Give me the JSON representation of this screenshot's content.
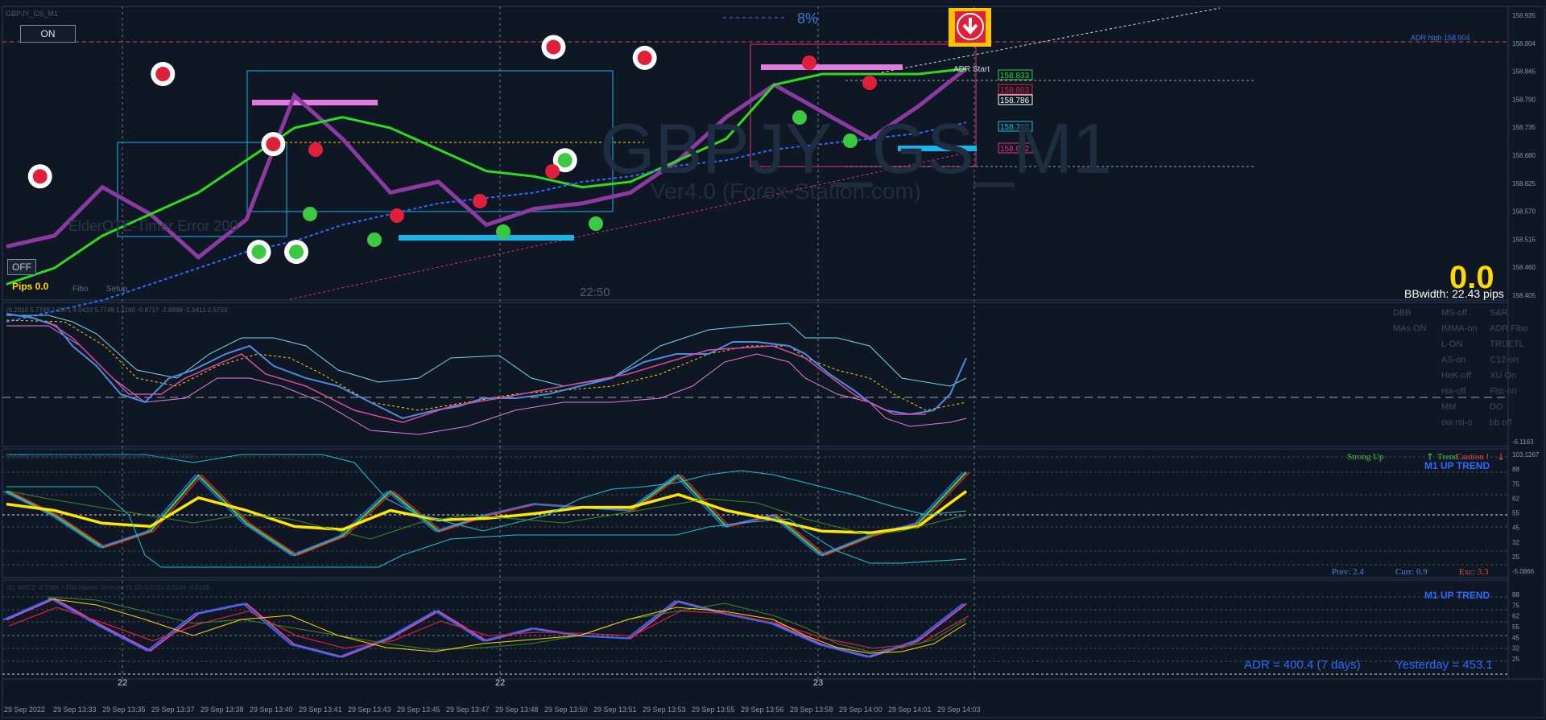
{
  "window": {
    "top_label": "GBPJY_GS_M1",
    "on_button": "ON",
    "off_button": "OFF"
  },
  "main_panel": {
    "watermark_symbol": "GBPJY_GS_M1",
    "watermark_brand": "Ver4.0 (Forex-Station.com)",
    "error_text": "ElderOTE-Timer Error 200",
    "pips_text": "Pips 0.0",
    "fibo_label": "Fibo",
    "setup_label": "Setup",
    "time_label": "22:50",
    "percent_label": "8%",
    "big_value": "0.0",
    "bbwidth_text": "BBwidth: 22.43 pips",
    "adr_label": "ADR Start",
    "price_tags": [
      {
        "text": "158.833",
        "color": "#2ecc40"
      },
      {
        "text": "158.803",
        "color": "#e0203a"
      },
      {
        "text": "158.786",
        "color": "#ffffff"
      },
      {
        "text": "158.735",
        "color": "#19c3d8"
      },
      {
        "text": "158.682",
        "color": "#e0307a"
      }
    ],
    "adr_right_tag": "ADR high 158.904",
    "axis_ticks": [
      "158.935",
      "158.904",
      "158.845",
      "158.790",
      "158.735",
      "158.680",
      "158.625",
      "158.570",
      "158.515",
      "158.460",
      "158.405"
    ]
  },
  "panel2": {
    "title": "(0.2010 5.7749 1.2871 4.0433 5.7749 1.1160 -0.8717 -2.9999 -1.9411 2.5733",
    "buttons": [
      [
        "DBB",
        "MS-off",
        "S&R"
      ],
      [
        "MAs ON",
        "IMMA-on",
        "ADR Fibo"
      ],
      [
        "",
        "L-ON",
        "TRUETL"
      ],
      [
        "",
        "AS-on",
        "C12-on"
      ],
      [
        "",
        "HeK-off",
        "XU On"
      ],
      [
        "",
        "rsx-off",
        "Fist-on"
      ],
      [
        "",
        "MM",
        "DO"
      ],
      [
        "",
        "ow rsi-o",
        "bb off"
      ]
    ],
    "right_value": "-6.1163"
  },
  "panel3": {
    "title": "(Ehlers) (28.84 (10.8) 63.8312 68.4734 55.1395 70.5963 84.5599)",
    "strong_up": "Strong Up",
    "trend": "Trend",
    "caution": "Caution !",
    "trend_label": "M1 UP TREND",
    "prev": "Prev: 2.4",
    "curr": "Curr: 0.9",
    "exc": "Exc: 3.3",
    "axis_ticks": [
      "103.1267",
      "88",
      "75",
      "62",
      "55",
      "45",
      "32",
      "25",
      "-5.0866"
    ]
  },
  "panel4": {
    "title": "M1 MACD of EMA + Flat Market Detector (8,13) 0.0251 0.0184 -0.0118",
    "trend_label": "M1 UP TREND",
    "adr_text": "ADR = 400.4  (7 days)",
    "yesterday_text": "Yesterday = 453.1",
    "axis_ticks": [
      "88",
      "75",
      "62",
      "55",
      "45",
      "32",
      "25"
    ]
  },
  "x_axis": {
    "day_markers": [
      "22",
      "22",
      "23"
    ],
    "time_labels": [
      "29 Sep 2022",
      "29 Sep 13:33",
      "29 Sep 13:35",
      "29 Sep 13:37",
      "29 Sep 13:38",
      "29 Sep 13:40",
      "29 Sep 13:41",
      "29 Sep 13:43",
      "29 Sep 13:45",
      "29 Sep 13:47",
      "29 Sep 13:48",
      "29 Sep 13:50",
      "29 Sep 13:51",
      "29 Sep 13:53",
      "29 Sep 13:55",
      "29 Sep 13:56",
      "29 Sep 13:58",
      "29 Sep 14:00",
      "29 Sep 14:01",
      "29 Sep 14:03"
    ]
  },
  "colors": {
    "background": "#0f1724",
    "panel_border": "#2a3a52",
    "grid": "#6f7c8c",
    "green_line": "#2ddc1c",
    "purple_line": "#8a3aa0",
    "blue_dash": "#2a6bff",
    "yellow": "#ffe600",
    "red_dot": "#e0203a",
    "green_dot": "#3ac940",
    "cyan_bar": "#18b4ec",
    "pink_bar": "#e07ce0"
  },
  "chart_data": [
    {
      "type": "line",
      "panel": "price",
      "title": "",
      "xlabel": "",
      "ylabel": "",
      "ylim": [
        158.405,
        158.935
      ],
      "x": [
        0,
        5,
        10,
        15,
        20,
        25,
        30,
        35,
        40,
        45,
        50,
        55,
        60,
        65,
        70,
        75,
        80,
        85,
        90,
        95,
        100
      ],
      "series": [
        {
          "name": "",
          "key": "price",
          "values": [
            158.5,
            158.52,
            158.61,
            158.56,
            158.48,
            158.55,
            158.78,
            158.7,
            158.6,
            158.62,
            158.54,
            158.57,
            158.58,
            158.6,
            158.66,
            158.74,
            158.8,
            158.75,
            158.7,
            158.76,
            158.83
          ]
        },
        {
          "name": "",
          "key": "ma_green",
          "values": [
            158.43,
            158.46,
            158.52,
            158.56,
            158.6,
            158.66,
            158.72,
            158.74,
            158.72,
            158.68,
            158.64,
            158.63,
            158.61,
            158.62,
            158.66,
            158.7,
            158.8,
            158.82,
            158.82,
            158.82,
            158.83
          ]
        },
        {
          "name": "",
          "key": "ma_blue",
          "values": [
            158.36,
            158.38,
            158.4,
            158.43,
            158.46,
            158.49,
            158.51,
            158.54,
            158.56,
            158.58,
            158.59,
            158.6,
            158.62,
            158.63,
            158.65,
            158.66,
            158.68,
            158.69,
            158.7,
            158.71,
            158.73
          ]
        }
      ],
      "markers": [
        {
          "type": "red",
          "x": 3.5,
          "y": 158.63
        },
        {
          "type": "red",
          "x": 16.3,
          "y": 158.82
        },
        {
          "type": "red",
          "x": 27.8,
          "y": 158.69
        },
        {
          "type": "red",
          "x": 57.0,
          "y": 158.87
        },
        {
          "type": "red",
          "x": 66.5,
          "y": 158.85
        },
        {
          "type": "green",
          "x": 26.3,
          "y": 158.49
        },
        {
          "type": "green",
          "x": 30.2,
          "y": 158.49
        },
        {
          "type": "green",
          "x": 58.2,
          "y": 158.66
        }
      ]
    },
    {
      "type": "line",
      "panel": "panel3",
      "title": "",
      "xlabel": "",
      "ylabel": "",
      "ylim": [
        25,
        88
      ],
      "x": [
        0,
        5,
        10,
        15,
        20,
        25,
        30,
        35,
        40,
        45,
        50,
        55,
        60,
        65,
        70,
        75,
        80,
        85,
        90,
        95,
        100
      ],
      "series": [
        {
          "name": "",
          "key": "fast",
          "values": [
            70,
            55,
            35,
            45,
            80,
            50,
            30,
            42,
            70,
            45,
            55,
            62,
            60,
            58,
            80,
            48,
            55,
            30,
            42,
            50,
            82
          ]
        },
        {
          "name": "",
          "key": "slow",
          "values": [
            62,
            58,
            50,
            48,
            66,
            58,
            48,
            46,
            58,
            52,
            53,
            56,
            60,
            60,
            68,
            58,
            52,
            45,
            44,
            48,
            70
          ]
        }
      ]
    },
    {
      "type": "line",
      "panel": "panel4",
      "title": "",
      "xlabel": "",
      "ylabel": "",
      "ylim": [
        25,
        88
      ],
      "x": [
        0,
        5,
        10,
        15,
        20,
        25,
        30,
        35,
        40,
        45,
        50,
        55,
        60,
        65,
        70,
        75,
        80,
        85,
        90,
        95,
        100
      ],
      "series": [
        {
          "name": "",
          "key": "macd",
          "values": [
            65,
            82,
            60,
            40,
            70,
            78,
            45,
            35,
            50,
            72,
            48,
            58,
            52,
            50,
            80,
            70,
            62,
            45,
            35,
            48,
            78
          ]
        },
        {
          "name": "",
          "key": "signal",
          "values": [
            60,
            75,
            62,
            48,
            62,
            72,
            52,
            42,
            48,
            64,
            52,
            55,
            54,
            52,
            72,
            70,
            62,
            50,
            42,
            46,
            68
          ]
        }
      ]
    }
  ]
}
